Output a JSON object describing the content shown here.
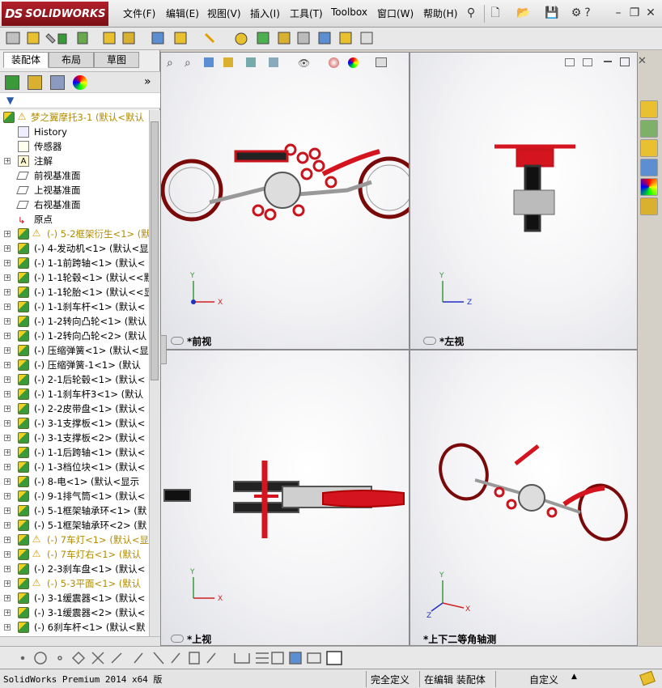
{
  "app": {
    "brand": "SOLIDWORKS",
    "brand_mark": "DS"
  },
  "menu": [
    "文件(F)",
    "编辑(E)",
    "视图(V)",
    "插入(I)",
    "工具(T)",
    "Toolbox",
    "窗口(W)",
    "帮助(H)"
  ],
  "panel_tabs": [
    "装配体",
    "布局",
    "草图"
  ],
  "tree": {
    "root": "梦之翼摩托3-1  (默认<默认",
    "items": [
      {
        "label": "History",
        "kind": "history"
      },
      {
        "label": "传感器",
        "kind": "sensor"
      },
      {
        "label": "注解",
        "kind": "annotation"
      },
      {
        "label": "前视基准面",
        "kind": "plane"
      },
      {
        "label": "上视基准面",
        "kind": "plane"
      },
      {
        "label": "右视基准面",
        "kind": "plane"
      },
      {
        "label": "原点",
        "kind": "origin"
      },
      {
        "label": "(-) 5-2框架衍生<1> (默认",
        "kind": "asm",
        "warn": true
      },
      {
        "label": "(-) 4-发动机<1> (默认<显",
        "kind": "asm"
      },
      {
        "label": "(-) 1-1前跨轴<1> (默认<",
        "kind": "asm"
      },
      {
        "label": "(-) 1-1轮毂<1> (默认<<默",
        "kind": "asm"
      },
      {
        "label": "(-) 1-1轮胎<1> (默认<<显",
        "kind": "asm"
      },
      {
        "label": "(-) 1-1刹车杆<1> (默认<",
        "kind": "asm"
      },
      {
        "label": "(-) 1-2转向凸轮<1> (默认",
        "kind": "asm"
      },
      {
        "label": "(-) 1-2转向凸轮<2> (默认",
        "kind": "asm"
      },
      {
        "label": "(-) 压缩弹簧<1> (默认<显",
        "kind": "asm"
      },
      {
        "label": "(-) 压缩弹簧-1<1> (默认",
        "kind": "asm"
      },
      {
        "label": "(-) 2-1后轮毂<1> (默认<",
        "kind": "asm"
      },
      {
        "label": "(-) 1-1刹车杆3<1> (默认",
        "kind": "asm"
      },
      {
        "label": "(-) 2-2皮带盘<1> (默认<",
        "kind": "asm"
      },
      {
        "label": "(-) 3-1支撑板<1> (默认<",
        "kind": "asm"
      },
      {
        "label": "(-) 3-1支撑板<2> (默认<",
        "kind": "asm"
      },
      {
        "label": "(-) 1-1后跨轴<1> (默认<",
        "kind": "asm"
      },
      {
        "label": "(-) 1-3档位块<1> (默认<",
        "kind": "asm"
      },
      {
        "label": "(-) 8-电<1> (默认<显示",
        "kind": "asm"
      },
      {
        "label": "(-) 9-1排气筒<1> (默认<",
        "kind": "asm"
      },
      {
        "label": "(-) 5-1框架轴承环<1> (默",
        "kind": "asm"
      },
      {
        "label": "(-) 5-1框架轴承环<2> (默",
        "kind": "asm"
      },
      {
        "label": "(-) 7车灯<1> (默认<显",
        "kind": "asm",
        "warn": true
      },
      {
        "label": "(-) 7车灯右<1> (默认",
        "kind": "asm",
        "warn": true
      },
      {
        "label": "(-) 2-3刹车盘<1> (默认<",
        "kind": "asm"
      },
      {
        "label": "(-) 5-3平面<1> (默认",
        "kind": "asm",
        "warn": true
      },
      {
        "label": "(-) 3-1缓震器<1> (默认<",
        "kind": "asm"
      },
      {
        "label": "(-) 3-1缓震器<2> (默认<",
        "kind": "asm"
      },
      {
        "label": "(-) 6刹车杆<1> (默认<默",
        "kind": "asm"
      }
    ]
  },
  "viewports": [
    {
      "label": "*前视",
      "axes": [
        "Y",
        "X"
      ]
    },
    {
      "label": "*左视",
      "axes": [
        "Y",
        "Z"
      ]
    },
    {
      "label": "*上视",
      "axes": [
        "Y",
        "X"
      ]
    },
    {
      "label": "*上下二等角轴测",
      "axes": [
        "Y",
        "X",
        "Z"
      ]
    }
  ],
  "status": {
    "version": "SolidWorks Premium 2014 x64 版",
    "defined": "完全定义",
    "editing": "在编辑 装配体",
    "custom": "自定义"
  },
  "colors": {
    "brand_red": "#b3202a",
    "model_red": "#d4141e",
    "warn": "#b08b00"
  }
}
